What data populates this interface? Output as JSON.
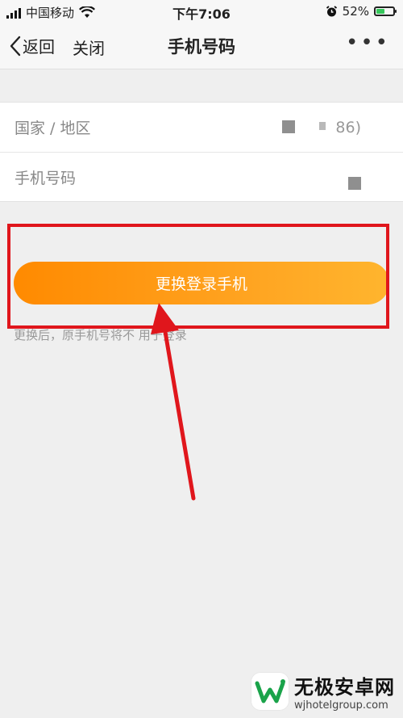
{
  "status_bar": {
    "carrier": "中国移动",
    "time": "下午7:06",
    "battery": "52%",
    "battery_level": 0.52
  },
  "nav": {
    "back_label": "返回",
    "close_label": "关闭",
    "title": "手机号码",
    "more_label": "•••"
  },
  "form": {
    "rows": [
      {
        "label": "国家 / 地区",
        "value": "86)"
      },
      {
        "label": "手机号码",
        "value": ""
      }
    ]
  },
  "primary_button": {
    "label": "更换登录手机"
  },
  "hint": {
    "text": "更换后，原手机号将不 用于登录"
  },
  "watermark": {
    "title": "无极安卓网",
    "url": "wjhotelgroup.com"
  },
  "colors": {
    "button_start": "#ff8a00",
    "button_end": "#ffb52e",
    "annotation": "#e0161c"
  }
}
